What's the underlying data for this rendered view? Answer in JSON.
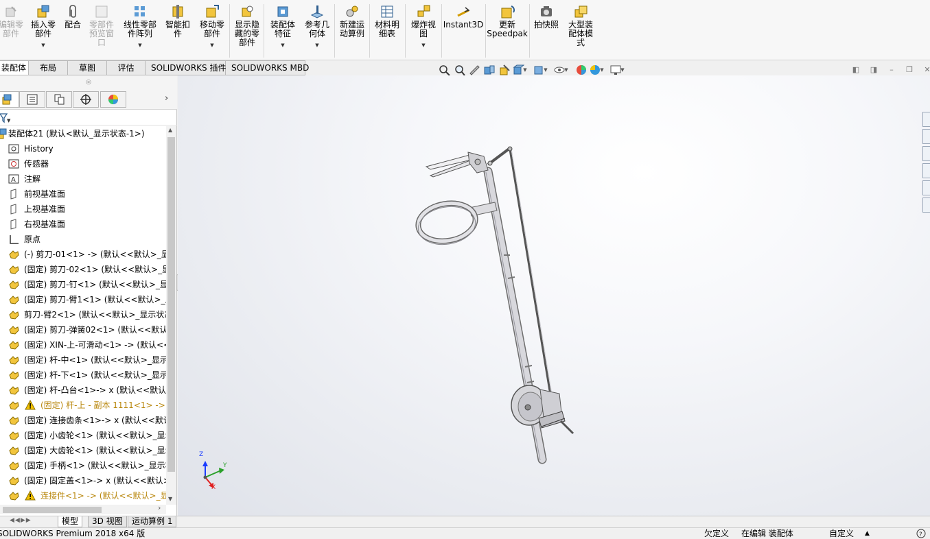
{
  "ribbon": {
    "items": [
      {
        "label": "编辑零\n部件",
        "disabled": true
      },
      {
        "label": "插入零\n部件",
        "dropdown": true
      },
      {
        "label": "配合"
      },
      {
        "label": "零部件\n预览窗\n口",
        "disabled": true
      },
      {
        "label": "线性零部\n件阵列",
        "dropdown": true
      },
      {
        "label": "智能扣\n件"
      },
      {
        "label": "移动零\n部件",
        "dropdown": true
      },
      {
        "label": "显示隐\n藏的零\n部件"
      },
      {
        "label": "装配体\n特征",
        "dropdown": true
      },
      {
        "label": "参考几\n何体",
        "dropdown": true
      },
      {
        "label": "新建运\n动算例"
      },
      {
        "label": "材料明\n细表"
      },
      {
        "label": "爆炸视\n图",
        "dropdown": true
      },
      {
        "label": "Instant3D"
      },
      {
        "label": "更新\nSpeedpak"
      },
      {
        "label": "拍快照"
      },
      {
        "label": "大型装\n配体模\n式"
      }
    ]
  },
  "tabs": [
    "装配体",
    "布局",
    "草图",
    "评估",
    "SOLIDWORKS 插件",
    "SOLIDWORKS MBD"
  ],
  "tree": {
    "root": "装配体21  (默认<默认_显示状态-1>)",
    "items": [
      {
        "label": "History",
        "icon": "history-icon"
      },
      {
        "label": "传感器",
        "icon": "sensor-icon"
      },
      {
        "label": "注解",
        "icon": "annotation-icon"
      },
      {
        "label": "前视基准面",
        "icon": "plane-icon"
      },
      {
        "label": "上视基准面",
        "icon": "plane-icon"
      },
      {
        "label": "右视基准面",
        "icon": "plane-icon"
      },
      {
        "label": "原点",
        "icon": "origin-icon"
      },
      {
        "label": "(-) 剪刀-01<1> -> (默认<<默认>_显示",
        "icon": "part-icon"
      },
      {
        "label": "(固定) 剪刀-02<1> (默认<<默认>_显示",
        "icon": "part-icon"
      },
      {
        "label": "(固定) 剪刀-钉<1> (默认<<默认>_显示",
        "icon": "part-icon"
      },
      {
        "label": "(固定) 剪刀-臂1<1> (默认<<默认>_显",
        "icon": "part-icon"
      },
      {
        "label": "剪刀-臂2<1> (默认<<默认>_显示状态",
        "icon": "part-icon"
      },
      {
        "label": "(固定) 剪刀-弹簧02<1> (默认<<默认>",
        "icon": "part-icon"
      },
      {
        "label": "(固定) XIN-上-可滑动<1> -> (默认<<",
        "icon": "part-icon"
      },
      {
        "label": "(固定) 杆-中<1> (默认<<默认>_显示状",
        "icon": "part-icon"
      },
      {
        "label": "(固定) 杆-下<1> (默认<<默认>_显示状",
        "icon": "part-icon"
      },
      {
        "label": "(固定) 杆-凸台<1>-> x (默认<<默认>",
        "icon": "part-icon"
      },
      {
        "label": "(固定) 杆-上 - 副本 1111<1> -> (",
        "icon": "part-icon",
        "warning": true
      },
      {
        "label": "(固定) 连接齿条<1>-> x (默认<<默认",
        "icon": "part-icon"
      },
      {
        "label": "(固定) 小齿轮<1> (默认<<默认>_显示",
        "icon": "part-icon"
      },
      {
        "label": "(固定) 大齿轮<1> (默认<<默认>_显示",
        "icon": "part-icon"
      },
      {
        "label": "(固定) 手柄<1> (默认<<默认>_显示状",
        "icon": "part-icon"
      },
      {
        "label": "(固定) 固定盖<1>-> x (默认<<默认>_",
        "icon": "part-icon"
      },
      {
        "label": "连接件<1> -> (默认<<默认>_显示",
        "icon": "part-icon",
        "warning": true
      }
    ]
  },
  "triad": {
    "x": "X",
    "y": "Y",
    "z": "Z"
  },
  "bottom_tabs": [
    "模型",
    "3D 视图",
    "运动算例 1"
  ],
  "status": {
    "product": "SOLIDWORKS Premium 2018 x64 版",
    "definition": "欠定义",
    "editing": "在编辑 装配体",
    "units": "自定义",
    "units_arrow": "▲"
  },
  "colors": {
    "accent": "#f2b705",
    "warning": "#b8860b"
  }
}
